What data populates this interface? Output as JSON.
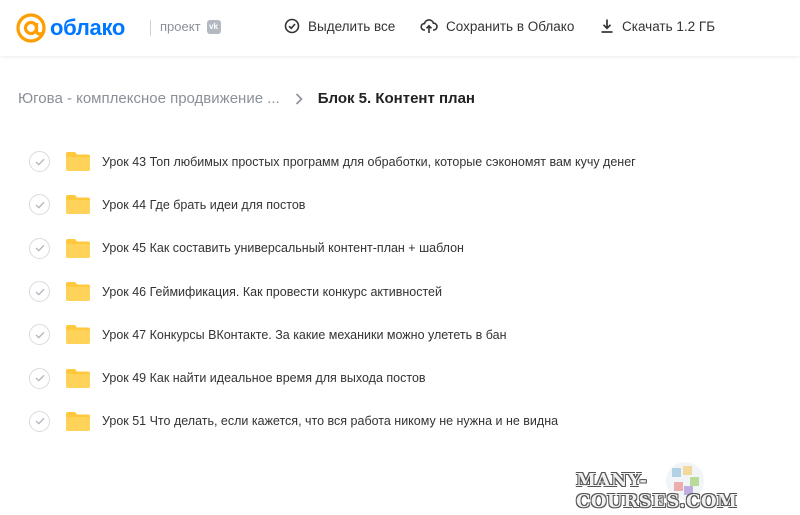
{
  "header": {
    "logo_text": "облако",
    "project_label": "проект",
    "project_badge": "vk",
    "actions": {
      "select_all": "Выделить все",
      "save_to_cloud": "Сохранить в Облако",
      "download": "Скачать 1.2 ГБ"
    }
  },
  "breadcrumb": {
    "parent": "Югова - комплексное продвижение ...",
    "current": "Блок 5. Контент план"
  },
  "items": [
    {
      "label": "Урок 43 Топ любимых простых программ для обработки, которые сэкономят вам кучу денег"
    },
    {
      "label": "Урок 44 Где брать идеи для постов"
    },
    {
      "label": "Урок 45 Как составить универсальный контент-план + шаблон"
    },
    {
      "label": "Урок 46 Геймификация. Как провести конкурс активностей"
    },
    {
      "label": "Урок 47 Конкурсы ВКонтакте. За какие механики можно улететь в бан"
    },
    {
      "label": "Урок 49 Как найти идеальное время для выхода постов"
    },
    {
      "label": "Урок 51 Что делать, если кажется, что вся работа никому не нужна и не видна"
    }
  ],
  "watermark": "MANY-COURSES.COM",
  "colors": {
    "brand": "#0077ff",
    "folder": "#ffc83d",
    "muted": "#8a9099"
  }
}
